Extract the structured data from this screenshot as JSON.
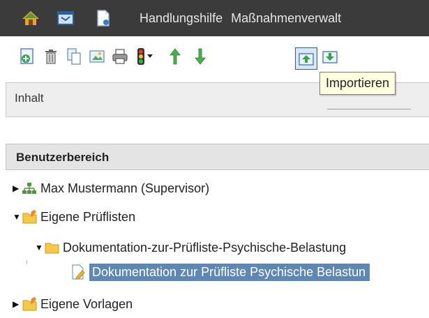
{
  "topnav": {
    "links": [
      "Handlungshilfe",
      "Maßnahmenverwalt"
    ],
    "icons": [
      "home-icon",
      "desktop-window-icon",
      "document-icon"
    ]
  },
  "toolbar": {
    "buttons": [
      "new-document-icon",
      "trash-icon",
      "copy-icon",
      "image-view-icon",
      "print-icon",
      "traffic-light-menu-icon",
      "arrow-up-icon",
      "arrow-down-icon",
      "import-icon",
      "export-icon"
    ],
    "tooltip": "Importieren"
  },
  "content_tab": {
    "label": "Inhalt"
  },
  "user_area": {
    "title": "Benutzerbereich",
    "tree": [
      {
        "label": "Max Mustermann (Supervisor)",
        "expanded": false,
        "icon": "org-chart-icon"
      },
      {
        "label": "Eigene Prüflisten",
        "expanded": true,
        "icon": "folder-edit-icon"
      },
      {
        "label": "Dokumentation-zur-Prüfliste-Psychische-Belastung",
        "expanded": true,
        "icon": "folder-icon"
      },
      {
        "label": "Dokumentation zur Prüfliste Psychische Belastun",
        "selected": true,
        "icon": "document-edit-icon"
      },
      {
        "label": "Eigene Vorlagen",
        "expanded": false,
        "icon": "folder-edit-icon"
      }
    ]
  },
  "colors": {
    "topbar": "#3b3b3b",
    "selection": "#5e87b3",
    "tooltip_bg": "#ffffe1"
  }
}
